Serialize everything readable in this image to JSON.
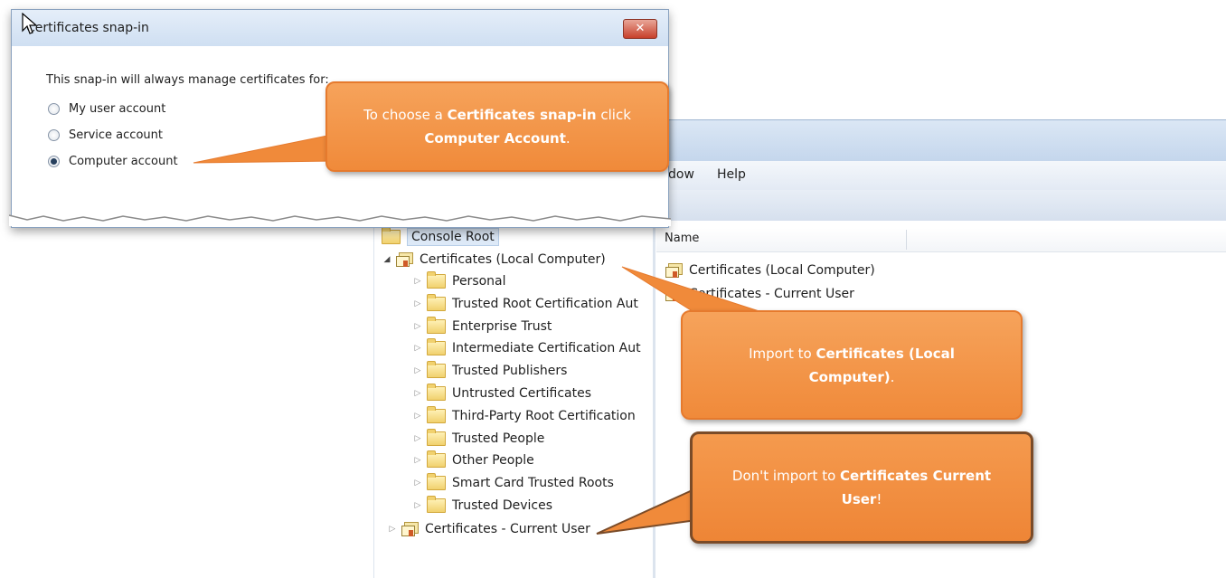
{
  "mmc": {
    "menu": {
      "window_partial": "dow",
      "help": "Help"
    },
    "tree": {
      "console_root": "Console Root",
      "local_computer": "Certificates (Local Computer)",
      "stores": [
        "Personal",
        "Trusted Root Certification Aut",
        "Enterprise Trust",
        "Intermediate Certification Aut",
        "Trusted Publishers",
        "Untrusted Certificates",
        "Third-Party Root Certification",
        "Trusted People",
        "Other People",
        "Smart Card Trusted Roots",
        "Trusted Devices"
      ],
      "current_user": "Certificates - Current User"
    },
    "list": {
      "column_name": "Name",
      "rows": [
        "Certificates (Local Computer)",
        "Certificates - Current User"
      ]
    }
  },
  "dialog": {
    "title": "Certificates snap-in",
    "close": "✕",
    "description": "This snap-in will always manage certificates for:",
    "options": [
      {
        "label": "My user account",
        "selected": false
      },
      {
        "label": "Service account",
        "selected": false
      },
      {
        "label": "Computer account",
        "selected": true
      }
    ]
  },
  "callouts": {
    "c1": {
      "pre": "To choose a ",
      "b1": "Certificates snap-in",
      "mid": " click ",
      "b2": "Computer Account",
      "post": "."
    },
    "c2": {
      "pre": "Import to ",
      "b1": "Certificates (Local Computer)",
      "post": "."
    },
    "c3": {
      "pre": "Don't import to ",
      "b1": "Certificates Current User",
      "post": "!"
    }
  },
  "colors": {
    "callout_orange": "#f08a3a",
    "title_blue": "#cfdff2",
    "close_red": "#c7402b"
  },
  "icons": [
    "folder-icon",
    "certificate-store-icon",
    "expand-arrow-icon",
    "collapse-arrow-icon",
    "close-icon",
    "mouse-cursor-icon"
  ]
}
